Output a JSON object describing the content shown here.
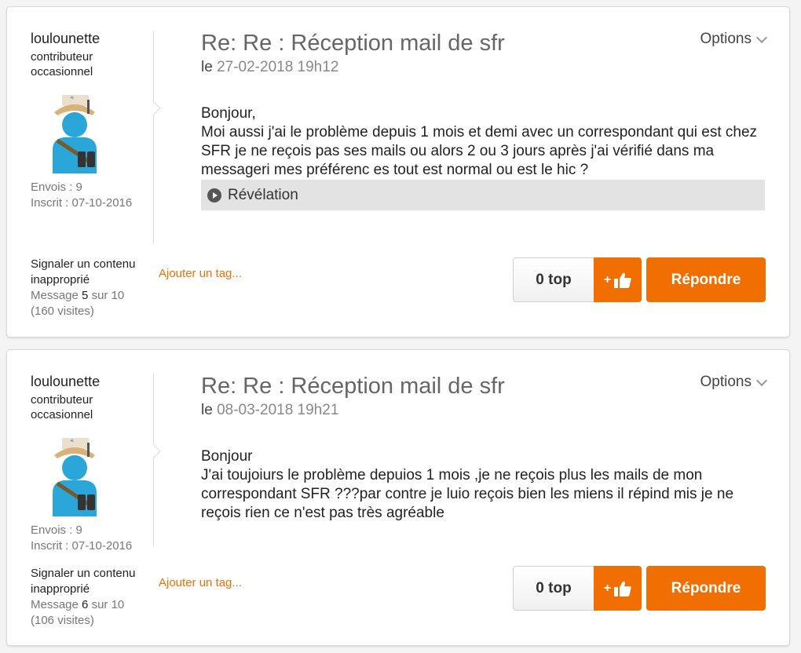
{
  "posts": [
    {
      "author": "loulounette",
      "rank": "contributeur occasionnel",
      "posts_label": "Envois : 9",
      "joined_label": "Inscrit : 07-10-2016",
      "subject": "Re: Re : Réception mail de sfr",
      "date_prefix": "le",
      "date": "27-02-2018 19h12",
      "options_label": "Options",
      "body": [
        "Bonjour,",
        "Moi aussi j'ai le problème  depuis 1 mois et demi avec un correspondant qui est chez SFR je ne reçois pas ses mails ou alors 2 ou 3 jours après j'ai vérifié dans ma messageri mes préférenc es tout est normal  ou est le hic ?"
      ],
      "spoiler_label": "Révélation",
      "report_label": "Signaler un contenu inapproprié",
      "message_prefix": "Message",
      "message_num": "5",
      "message_suffix": "sur 10",
      "visits": "(160 visites)",
      "add_tag": "Ajouter un tag...",
      "kudos": "0 top",
      "kudo_plus": "+",
      "reply": "Répondre"
    },
    {
      "author": "loulounette",
      "rank": "contributeur occasionnel",
      "posts_label": "Envois : 9",
      "joined_label": "Inscrit : 07-10-2016",
      "subject": "Re: Re : Réception mail de sfr",
      "date_prefix": "le",
      "date": "08-03-2018 19h21",
      "options_label": "Options",
      "body": [
        "Bonjour",
        "J'ai toujoiurs le problème depuios 1 mois ,je ne reçois plus les mails de mon correspondant SFR ???par contre  je luio reçois bien les miens il répind mis je ne reçois rien  ce n'est pas très agréable"
      ],
      "report_label": "Signaler un contenu inapproprié",
      "message_prefix": "Message",
      "message_num": "6",
      "message_suffix": "sur 10",
      "visits": "(106 visites)",
      "add_tag": "Ajouter un tag...",
      "kudos": "0 top",
      "kudo_plus": "+",
      "reply": "Répondre"
    }
  ],
  "colors": {
    "accent": "#f16e00",
    "muted_text": "#777777",
    "subject_text": "#666666"
  },
  "icons": {
    "avatar": "explorer-avatar",
    "options_chevron": "chevron-down-icon",
    "spoiler": "play-circle-icon",
    "kudo": "thumbs-up-icon"
  }
}
